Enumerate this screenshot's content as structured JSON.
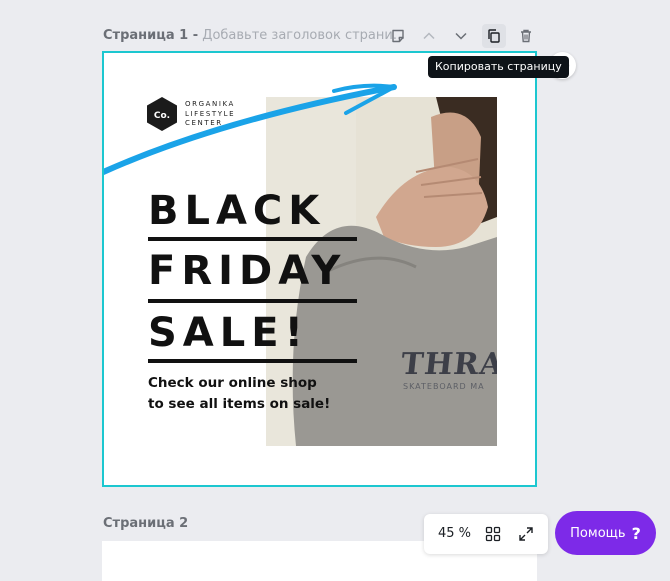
{
  "page1": {
    "number_label": "Страница 1 -",
    "title_placeholder": "Добавьте заголовок страни..."
  },
  "toolbar": {
    "tooltip": "Копировать страницу",
    "icons": [
      "note-icon",
      "chevron-up-icon",
      "chevron-down-icon",
      "copy-page-icon",
      "trash-icon"
    ]
  },
  "design": {
    "logo_badge": "Co.",
    "logo_lines": [
      "ORGANIKA",
      "LIFESTYLE",
      "CENTER"
    ],
    "headline": [
      "BLACK",
      "FRIDAY",
      "SALE!"
    ],
    "subtext_line1": "Check our online shop",
    "subtext_line2": "to see all items on sale!",
    "shirt_text": "THRASH",
    "shirt_subtext": "SKATEBOARD MA",
    "accent_color": "#1cc7d0",
    "stroke_color": "#1aa3e8"
  },
  "page2": {
    "label": "Страница 2"
  },
  "zoom": {
    "value": "45 %"
  },
  "help": {
    "label": "Помощь",
    "icon_text": "?",
    "color": "#7d2ae8"
  }
}
